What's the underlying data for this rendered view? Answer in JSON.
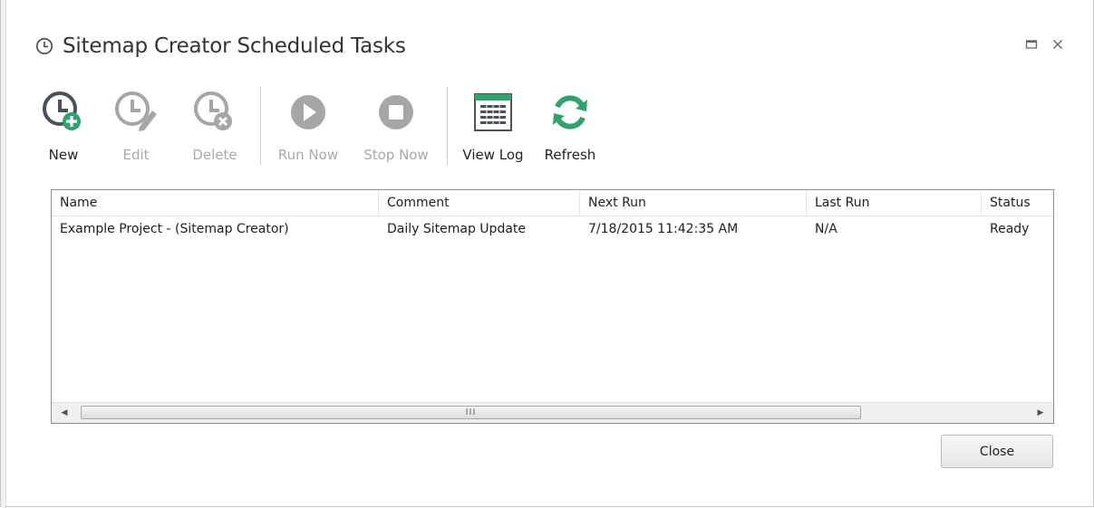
{
  "window": {
    "title": "Sitemap Creator Scheduled Tasks",
    "icon": "clock-icon",
    "controls": [
      "maximize-icon",
      "close-icon"
    ]
  },
  "toolbar": {
    "new_label": "New",
    "edit_label": "Edit",
    "delete_label": "Delete",
    "run_now_label": "Run Now",
    "stop_now_label": "Stop Now",
    "view_log_label": "View Log",
    "refresh_label": "Refresh"
  },
  "grid": {
    "columns": [
      "Name",
      "Comment",
      "Next Run",
      "Last Run",
      "Status"
    ],
    "rows": [
      {
        "name": "Example Project - (Sitemap Creator)",
        "comment": "Daily Sitemap Update",
        "next_run": "7/18/2015 11:42:35 AM",
        "last_run": "N/A",
        "status": "Ready"
      }
    ],
    "scrollbar_grip": "III"
  },
  "footer": {
    "close_label": "Close"
  },
  "colors": {
    "accent_green": "#2fa36b",
    "icon_dark": "#4a5158",
    "disabled": "#a6a6a6"
  }
}
